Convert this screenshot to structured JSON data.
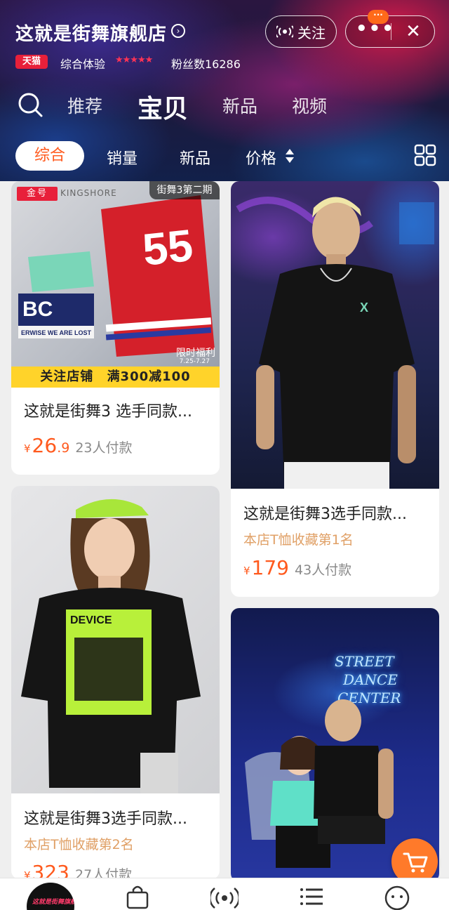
{
  "store": {
    "name": "这就是街舞旗舰店",
    "follow_label": "关注",
    "more_label": "•••",
    "close_label": "✕",
    "notify_badge": "···",
    "tmall_badge": "天猫",
    "experience_label": "综合体验",
    "star_rating": "★★★★★",
    "fans_text": "粉丝数16286"
  },
  "tabs": [
    {
      "label": "推荐"
    },
    {
      "label": "宝贝"
    },
    {
      "label": "新品"
    },
    {
      "label": "视频"
    }
  ],
  "active_tab": "宝贝",
  "sort": {
    "comprehensive": "综合",
    "sales": "销量",
    "new": "新品",
    "price": "价格"
  },
  "products": [
    {
      "badge": "金号",
      "brand": "KINGSHORE",
      "season_tag": "街舞3第二期",
      "limit_tag": "限时福利",
      "limit_date": "7.25-7.27",
      "promo": "关注店铺",
      "promo_deal": "满300减100",
      "title": "这就是街舞3 选手同款...",
      "price_int": "26",
      "price_dec": ".9",
      "paid": "23人付款"
    },
    {
      "title": "这就是街舞3选手同款...",
      "subtitle": "本店T恤收藏第1名",
      "price_int": "179",
      "paid": "43人付款"
    },
    {
      "title": "这就是街舞3选手同款...",
      "subtitle": "本店T恤收藏第2名",
      "price_int": "323",
      "paid": "27人付款"
    },
    {
      "neon_lines": [
        "STREET",
        "DANCE",
        "CENTER"
      ]
    }
  ],
  "currency": "¥",
  "colors": {
    "accent": "#ff5a1e",
    "tmall_red": "#e8203a",
    "promo_yellow": "#ffd32a",
    "cart_orange": "#ff7a2a"
  },
  "bottom_bar": {
    "icons": [
      "store-logo",
      "shopping-bag-icon",
      "live-broadcast-icon",
      "category-list-icon",
      "customer-service-icon"
    ]
  }
}
